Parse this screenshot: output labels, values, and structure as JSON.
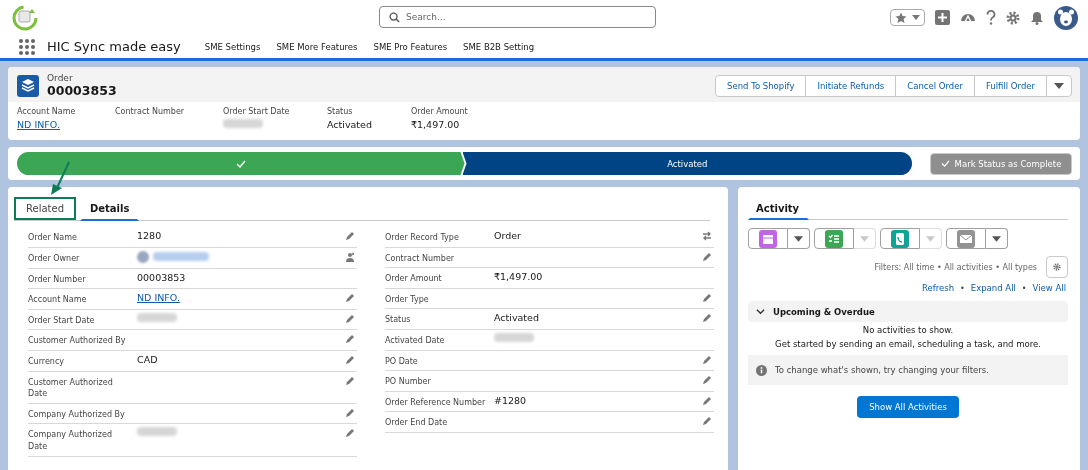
{
  "global_header": {
    "search": {
      "placeholder": "Search..."
    }
  },
  "app_nav": {
    "app_name": "HIC Sync made easy",
    "items": [
      {
        "label": "SME Settings",
        "selected": false
      },
      {
        "label": "SME More Features",
        "selected": false
      },
      {
        "label": "SME Pro Features",
        "selected": false
      },
      {
        "label": "SME B2B Setting",
        "selected": false
      }
    ]
  },
  "record_header": {
    "object_label": "Order",
    "record_name": "00003853",
    "actions": [
      "Send To Shopify",
      "Initiate Refunds",
      "Cancel Order",
      "Fulfill Order"
    ],
    "highlights": [
      {
        "label": "Account Name",
        "value": "ND INFO.",
        "kind": "link"
      },
      {
        "label": "Contract Number",
        "kind": "empty"
      },
      {
        "label": "Order Start Date",
        "kind": "redacted"
      },
      {
        "label": "Status",
        "value": "Activated",
        "kind": "text"
      },
      {
        "label": "Order Amount",
        "value": "₹1,497.00",
        "kind": "text"
      }
    ]
  },
  "path": {
    "stages": [
      {
        "kind": "complete"
      },
      {
        "kind": "current",
        "label": "Activated"
      }
    ],
    "button": {
      "label": "Mark Status as Complete",
      "disabled": true
    }
  },
  "detail_tabs": [
    {
      "label": "Related",
      "selected": false,
      "highlighted": true
    },
    {
      "label": "Details",
      "selected": true,
      "highlighted": false
    }
  ],
  "details": {
    "left": [
      {
        "label": "Order Name",
        "kind": "text",
        "value": "1280",
        "action": {
          "kind": "edit"
        }
      },
      {
        "label": "Order Owner",
        "kind": "redacted-user",
        "action": {
          "kind": "change-owner"
        }
      },
      {
        "label": "Order Number",
        "kind": "text",
        "value": "00003853"
      },
      {
        "label": "Account Name",
        "kind": "link",
        "value": "ND INFO.",
        "action": {
          "kind": "edit"
        }
      },
      {
        "label": "Order Start Date",
        "kind": "redacted",
        "action": {
          "kind": "edit"
        }
      },
      {
        "label": "Customer Authorized By",
        "kind": "empty",
        "action": {
          "kind": "edit"
        }
      },
      {
        "label": "Currency",
        "kind": "text",
        "value": "CAD",
        "action": {
          "kind": "edit"
        }
      },
      {
        "label": "Customer Authorized Date",
        "kind": "empty",
        "action": {
          "kind": "edit"
        }
      },
      {
        "label": "Company Authorized By",
        "kind": "empty",
        "action": {
          "kind": "edit"
        }
      },
      {
        "label": "Company Authorized Date",
        "kind": "redacted",
        "action": {
          "kind": "edit"
        }
      }
    ],
    "right": [
      {
        "label": "Order Record Type",
        "kind": "text",
        "value": "Order",
        "action": {
          "kind": "change-type"
        }
      },
      {
        "label": "Contract Number",
        "kind": "empty",
        "action": {
          "kind": "edit"
        }
      },
      {
        "label": "Order Amount",
        "kind": "text",
        "value": "₹1,497.00"
      },
      {
        "label": "Order Type",
        "kind": "empty",
        "action": {
          "kind": "edit"
        }
      },
      {
        "label": "Status",
        "kind": "text",
        "value": "Activated",
        "action": {
          "kind": "edit"
        }
      },
      {
        "label": "Activated Date",
        "kind": "redacted"
      },
      {
        "label": "PO Date",
        "kind": "empty",
        "action": {
          "kind": "edit"
        }
      },
      {
        "label": "PO Number",
        "kind": "empty",
        "action": {
          "kind": "edit"
        }
      },
      {
        "label": "Order Reference Number",
        "kind": "text",
        "value": "#1280",
        "action": {
          "kind": "edit"
        }
      },
      {
        "label": "Order End Date",
        "kind": "empty",
        "action": {
          "kind": "edit"
        }
      }
    ]
  },
  "activity": {
    "tab": "Activity",
    "composers": [
      {
        "kind": "event",
        "color": "#c563e8",
        "disabled": false
      },
      {
        "kind": "task",
        "color": "#3ba755",
        "disabled": true
      },
      {
        "kind": "call",
        "color": "#0fa596",
        "disabled": true
      },
      {
        "kind": "email",
        "color": "#939393",
        "disabled": false
      }
    ],
    "filters": "Filters: All time • All activities • All types",
    "links": [
      "Refresh",
      "Expand All",
      "View All"
    ],
    "link_separator": "•",
    "section": {
      "title": "Upcoming & Overdue",
      "expanded": true
    },
    "empty_title": "No activities to show.",
    "empty_text": "Get started by sending an email, scheduling a task, and more.",
    "tip": "To change what's shown, try changing your filters.",
    "show_all": "Show All Activities"
  }
}
